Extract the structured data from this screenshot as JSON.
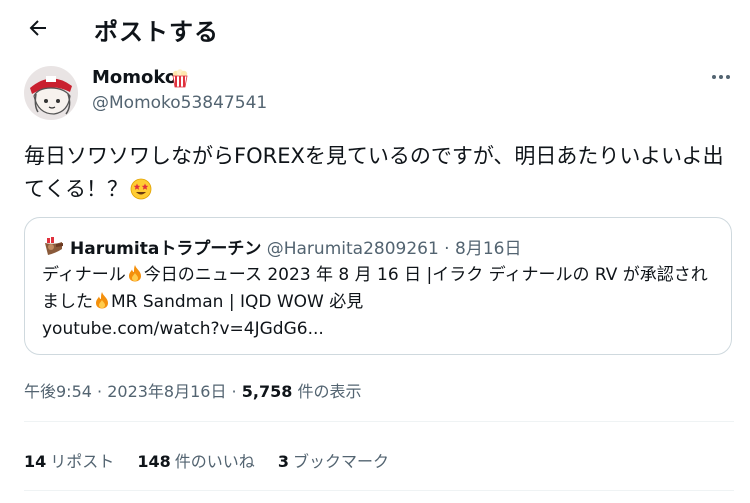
{
  "header": {
    "title": "ポストする"
  },
  "author": {
    "name": "Momoko",
    "handle": "@Momoko53847541"
  },
  "tweet": {
    "text": "毎日ソワソワしながらFOREXを見ているのですが、明日あたりいよいよ出てくる！？"
  },
  "quote": {
    "author_name": "Harumitaトラプーチン",
    "author_handle": "@Harumita2809261",
    "separator": " · ",
    "date": "8月16日",
    "text_1": "ディナール",
    "text_2": "今日のニュース 2023 年 8 月 16 日 |イラク ディナールの RV が承認されました",
    "text_3": "MR Sandman | IQD WOW 必見",
    "link": "youtube.com/watch?v=4JGdG6..."
  },
  "meta": {
    "time": "午後9:54",
    "date": "2023年8月16日",
    "separator": " · ",
    "views_count": "5,758",
    "views_label": "件の表示"
  },
  "stats": {
    "reposts_count": "14",
    "reposts_label": "リポスト",
    "likes_count": "148",
    "likes_label": "件のいいね",
    "bookmarks_count": "3",
    "bookmarks_label": "ブックマーク"
  },
  "icons": {
    "back": "arrow-left-icon",
    "more": "more-dots-icon",
    "emoji": "star-struck-emoji-icon",
    "fire": "fire-emoji-icon",
    "popcorn": "popcorn-emoji-icon"
  },
  "colors": {
    "text": "#0f1419",
    "secondary": "#536471",
    "border": "#cfd9de",
    "divider": "#eff3f4"
  }
}
